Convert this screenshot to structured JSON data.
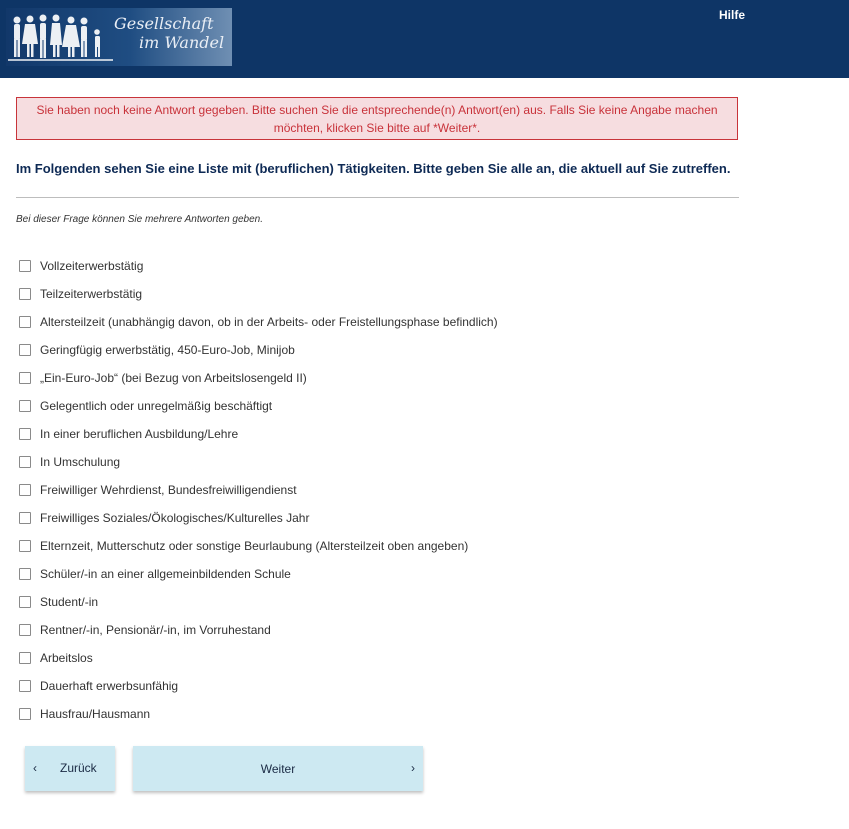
{
  "header": {
    "logo_line1": "Gesellschaft",
    "logo_line2": "im Wandel",
    "help_label": "Hilfe"
  },
  "error_message": "Sie haben noch keine Antwort gegeben. Bitte suchen Sie die entsprechende(n) Antwort(en) aus. Falls Sie keine Angabe machen möchten, klicken Sie bitte auf *Weiter*.",
  "question": "Im Folgenden sehen Sie eine Liste mit (beruflichen) Tätigkeiten. Bitte geben Sie alle an, die aktuell auf Sie zutreffen.",
  "hint": "Bei dieser Frage können Sie mehrere Antworten geben.",
  "options": [
    "Vollzeiterwerbstätig",
    "Teilzeiterwerbstätig",
    "Altersteilzeit (unabhängig davon, ob in der Arbeits- oder Freistellungsphase befindlich)",
    "Geringfügig erwerbstätig, 450-Euro-Job, Minijob",
    "„Ein-Euro-Job“ (bei Bezug von Arbeitslosengeld II)",
    "Gelegentlich oder unregelmäßig beschäftigt",
    "In einer beruflichen Ausbildung/Lehre",
    "In Umschulung",
    "Freiwilliger Wehrdienst, Bundesfreiwilligendienst",
    "Freiwilliges Soziales/Ökologisches/Kulturelles Jahr",
    "Elternzeit, Mutterschutz oder sonstige Beurlaubung (Altersteilzeit oben angeben)",
    "Schüler/-in an einer allgemeinbildenden Schule",
    "Student/-in",
    "Rentner/-in, Pensionär/-in, im Vorruhestand",
    "Arbeitslos",
    "Dauerhaft erwerbsunfähig",
    "Hausfrau/Hausmann"
  ],
  "nav": {
    "back_label": "Zurück",
    "next_label": "Weiter",
    "back_icon": "chevron-left-icon",
    "next_icon": "chevron-right-icon"
  },
  "colors": {
    "header_bg": "#0e3566",
    "error_border": "#c8343a",
    "error_bg": "#f6dde0",
    "button_bg": "#cde9f2"
  }
}
